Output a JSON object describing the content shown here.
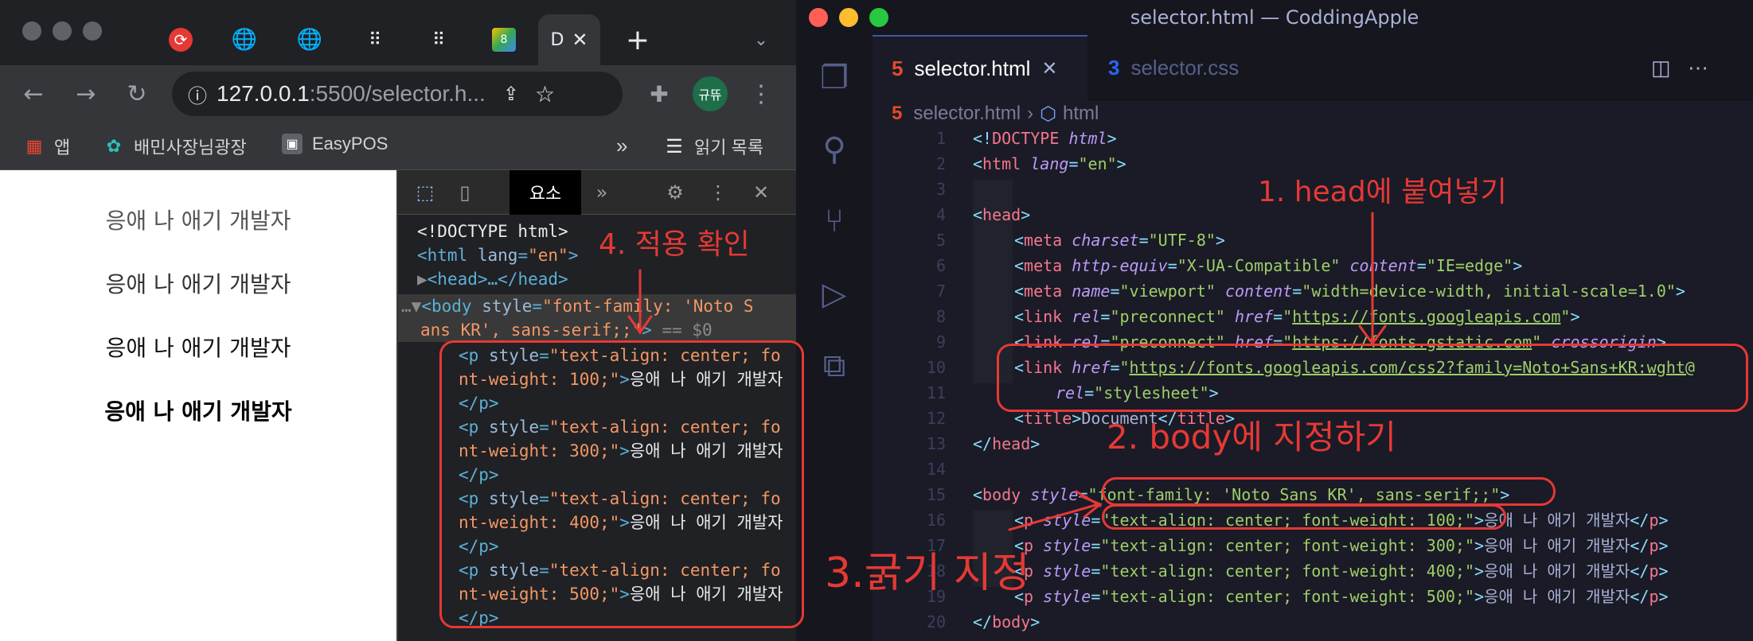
{
  "browser": {
    "tabs": [
      {
        "icon": "sync-icon",
        "label": "·"
      },
      {
        "icon": "globe-icon",
        "label": "·"
      },
      {
        "icon": "globe-icon",
        "label": "|"
      },
      {
        "icon": "dots-icon",
        "label": "·"
      },
      {
        "icon": "dots-icon",
        "label": ""
      },
      {
        "icon": "logo-icon",
        "label": ""
      },
      {
        "icon": "",
        "label": "D"
      }
    ],
    "new_tab": "+",
    "url_host": "127.0.0.1",
    "url_rest": ":5500/selector.h...",
    "profile": "규뜌",
    "bookmarks": [
      "앱",
      "배민사장님광장",
      "EasyPOS"
    ],
    "reading_list": "읽기 목록",
    "more": "»"
  },
  "page": {
    "lines": [
      "응애 나 애기 개발자",
      "응애 나 애기 개발자",
      "응애 나 애기 개발자",
      "응애 나 애기 개발자"
    ]
  },
  "devtools": {
    "tab": "요소",
    "more": "»",
    "dom": {
      "doctype": "<!DOCTYPE html>",
      "html_open": "<html",
      "html_attr": "lang",
      "html_val": "\"en\"",
      "head": "<head>…</head>",
      "body_tag": "<body",
      "body_attr": "style",
      "body_val1": "\"font-family: 'Noto S",
      "body_val2": "ans KR', sans-serif;;\"",
      "body_eq": "== $0",
      "p_tag": "<p",
      "p_attr": "style",
      "p_val_prefix": "\"text-align: center; fo",
      "p_items": [
        {
          "weight": "nt-weight: 100;\"",
          "text": "응애 나 애기 개발자"
        },
        {
          "weight": "nt-weight: 300;\"",
          "text": "응애 나 애기 개발자"
        },
        {
          "weight": "nt-weight: 400;\"",
          "text": "응애 나 애기 개발자"
        },
        {
          "weight": "nt-weight: 500;\"",
          "text": "응애 나 애기 개발자"
        }
      ],
      "p_close": "</p>"
    }
  },
  "vscode": {
    "title": "selector.html — CoddingApple",
    "tabs": [
      {
        "label": "selector.html",
        "active": true
      },
      {
        "label": "selector.css",
        "active": false
      }
    ],
    "breadcrumb": [
      "selector.html",
      "html"
    ],
    "lines": [
      {
        "n": "1",
        "code": "<!DOCTYPE html>"
      },
      {
        "n": "2",
        "code": "<html lang=\"en\">"
      },
      {
        "n": "3",
        "code": ""
      },
      {
        "n": "4",
        "code": "<head>"
      },
      {
        "n": "5",
        "code": "<meta charset=\"UTF-8\">"
      },
      {
        "n": "6",
        "code": "<meta http-equiv=\"X-UA-Compatible\" content=\"IE=edge\">"
      },
      {
        "n": "7",
        "code": "<meta name=\"viewport\" content=\"width=device-width, initial-scale=1.0\">"
      },
      {
        "n": "8",
        "code": "<link rel=\"preconnect\" href=\"https://fonts.googleapis.com\">"
      },
      {
        "n": "9",
        "code": "<link rel=\"preconnect\" href=\"https://fonts.gstatic.com\" crossorigin>"
      },
      {
        "n": "10",
        "code": "<link href=\"https://fonts.googleapis.com/css2?family=Noto+Sans+KR:wght@"
      },
      {
        "n": "11",
        "code": "rel=\"stylesheet\">"
      },
      {
        "n": "12",
        "code": "<title>Document</title>"
      },
      {
        "n": "13",
        "code": "</head>"
      },
      {
        "n": "14",
        "code": ""
      },
      {
        "n": "15",
        "code": "<body style=\"font-family: 'Noto Sans KR', sans-serif;;\">"
      },
      {
        "n": "16",
        "code": "<p style=\"text-align: center; font-weight: 100;\">응애 나 애기 개발자</p>"
      },
      {
        "n": "17",
        "code": "<p style=\"text-align: center; font-weight: 300;\">응애 나 애기 개발자</p>"
      },
      {
        "n": "18",
        "code": "<p style=\"text-align: center; font-weight: 400;\">응애 나 애기 개발자</p>"
      },
      {
        "n": "19",
        "code": "<p style=\"text-align: center; font-weight: 500;\">응애 나 애기 개발자</p>"
      },
      {
        "n": "20",
        "code": "</body>"
      }
    ]
  },
  "annotations": {
    "step1": "1. head에 붙여넣기",
    "step2": "2. body에 지정하기",
    "step3": "3.굵기 지정",
    "step4": "4. 적용 확인"
  },
  "colors": {
    "annotation": "#e53935",
    "vscode_bg": "#1a1b26",
    "chrome_dark": "#202124"
  }
}
